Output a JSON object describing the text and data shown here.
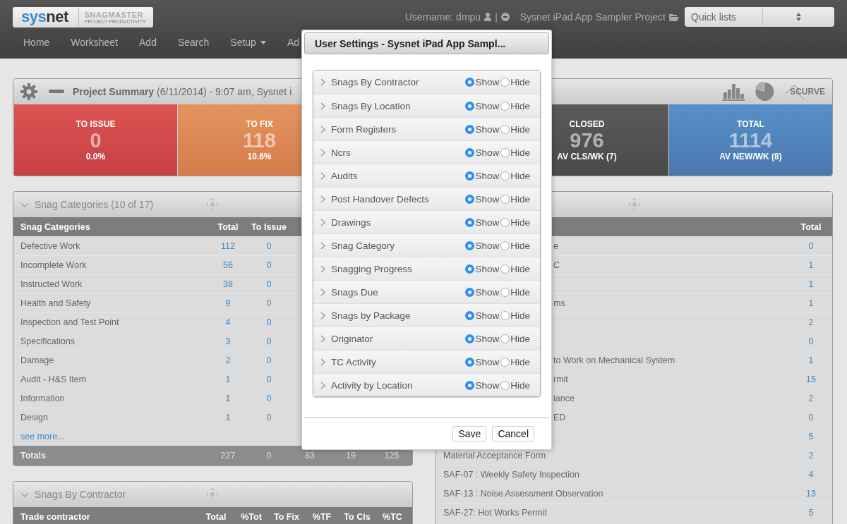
{
  "header": {
    "logo": {
      "brand": [
        "sys",
        "net"
      ],
      "product": "SNAGMASTER",
      "tagline": "PROJECT PRODUCTIVITY"
    },
    "username": "Username: dmpu",
    "separator": "|",
    "project": "Sysnet iPad App Sampler Project",
    "quick_lists": {
      "value": "Quick lists"
    }
  },
  "nav": [
    {
      "label": "Home",
      "dropdown": false
    },
    {
      "label": "Worksheet",
      "dropdown": false
    },
    {
      "label": "Add",
      "dropdown": false
    },
    {
      "label": "Search",
      "dropdown": false
    },
    {
      "label": "Setup",
      "dropdown": true
    },
    {
      "label": "Ad",
      "dropdown": false
    }
  ],
  "summary": {
    "title": "Project Summary",
    "subtitle": "(6/11/2014) - 9:07 am,  Sysnet i",
    "curve_button": "SCURVE",
    "cards": [
      {
        "kind": "issue",
        "label": "TO ISSUE",
        "value": "0",
        "note": "0.0%"
      },
      {
        "kind": "fix",
        "label": "TO FIX",
        "value": "118",
        "note": "10.6%"
      },
      {
        "kind": "closed",
        "label": "CLOSED",
        "value": "976",
        "note": "AV CLS/WK (7)"
      },
      {
        "kind": "total",
        "label": "TOTAL",
        "value": "1114",
        "note": "AV NEW/WK (8)"
      }
    ]
  },
  "categories_panel": {
    "title": "Snag Categories (10 of 17)",
    "columns": [
      "Snag Categories",
      "Total",
      "To Issue"
    ],
    "rows": [
      {
        "name": "Defective Work",
        "total": "112",
        "to_issue": "0"
      },
      {
        "name": "Incomplete Work",
        "total": "56",
        "to_issue": "0"
      },
      {
        "name": "Instructed Work",
        "total": "38",
        "to_issue": "0"
      },
      {
        "name": "Health and Safety",
        "total": "9",
        "to_issue": "0"
      },
      {
        "name": "Inspection and Test Point",
        "total": "4",
        "to_issue": "0"
      },
      {
        "name": "Specifications",
        "total": "3",
        "to_issue": "0"
      },
      {
        "name": "Damage",
        "total": "2",
        "to_issue": "0"
      },
      {
        "name": "Audit - H&S Item",
        "total": "1",
        "to_issue": "0"
      },
      {
        "name": "Information",
        "total": "1",
        "to_issue": "0"
      },
      {
        "name": "Design",
        "total": "1",
        "to_issue": "0"
      }
    ],
    "see_more": "see more...",
    "totals": [
      "Totals",
      "227",
      "0",
      "83",
      "19",
      "125"
    ]
  },
  "contractor_panel": {
    "title": "Snags By Contractor",
    "columns": [
      "Trade contractor",
      "Total",
      "%Tot",
      "To Fix",
      "%TF",
      "To Cls",
      "%TC"
    ]
  },
  "right_panel": {
    "columns": [
      "Total"
    ],
    "rows": [
      {
        "name": "e",
        "total": "0"
      },
      {
        "name": "C",
        "total": "1"
      },
      {
        "total": "1"
      },
      {
        "name": "ms",
        "total": "1"
      },
      {
        "total": "2"
      },
      {
        "total": "0"
      },
      {
        "name": "to Work on Mechanical System",
        "total": "1"
      },
      {
        "name": "rmit",
        "total": "15"
      },
      {
        "name": "iance",
        "total": "2"
      },
      {
        "name": "ED",
        "total": "0"
      },
      {
        "total": "5"
      },
      {
        "name": "Material Acceptance Form",
        "total": "2"
      },
      {
        "name": "SAF-07 : Weekly Safety Inspection",
        "total": "4"
      },
      {
        "name": "SAF-13 : Noise Assessment Observation",
        "total": "13"
      },
      {
        "name": "SAF-27: Hot Works Permit",
        "total": "5"
      }
    ]
  },
  "modal": {
    "title": "User Settings - Sysnet iPad App Sampl...",
    "items": [
      {
        "label": "Snags By Contractor",
        "options": [
          {
            "label": "Show",
            "selected": true
          },
          {
            "label": "Hide",
            "selected": false
          }
        ]
      },
      {
        "label": "Snags By Location",
        "options": [
          {
            "label": "Show",
            "selected": true
          },
          {
            "label": "Hide",
            "selected": false
          }
        ]
      },
      {
        "label": "Form Registers",
        "options": [
          {
            "label": "Show",
            "selected": true
          },
          {
            "label": "Hide",
            "selected": false
          }
        ]
      },
      {
        "label": "Ncrs",
        "options": [
          {
            "label": "Show",
            "selected": true
          },
          {
            "label": "Hide",
            "selected": false
          }
        ]
      },
      {
        "label": "Audits",
        "options": [
          {
            "label": "Show",
            "selected": true
          },
          {
            "label": "Hide",
            "selected": false
          }
        ]
      },
      {
        "label": "Post Handover Defects",
        "options": [
          {
            "label": "Show",
            "selected": true
          },
          {
            "label": "Hide",
            "selected": false
          }
        ]
      },
      {
        "label": "Drawings",
        "options": [
          {
            "label": "Show",
            "selected": true
          },
          {
            "label": "Hide",
            "selected": false
          }
        ]
      },
      {
        "label": "Snag Category",
        "options": [
          {
            "label": "Show",
            "selected": true
          },
          {
            "label": "Hide",
            "selected": false
          }
        ]
      },
      {
        "label": "Snagging Progress",
        "options": [
          {
            "label": "Show",
            "selected": true
          },
          {
            "label": "Hide",
            "selected": false
          }
        ]
      },
      {
        "label": "Snags Due",
        "options": [
          {
            "label": "Show",
            "selected": true
          },
          {
            "label": "Hide",
            "selected": false
          }
        ]
      },
      {
        "label": "Snags by Package",
        "options": [
          {
            "label": "Show",
            "selected": true
          },
          {
            "label": "Hide",
            "selected": false
          }
        ]
      },
      {
        "label": "Originator",
        "options": [
          {
            "label": "Show",
            "selected": true
          },
          {
            "label": "Hide",
            "selected": false
          }
        ]
      },
      {
        "label": "TC Activity",
        "options": [
          {
            "label": "Show",
            "selected": true
          },
          {
            "label": "Hide",
            "selected": false
          }
        ]
      },
      {
        "label": "Activity by Location",
        "options": [
          {
            "label": "Show",
            "selected": true
          },
          {
            "label": "Hide",
            "selected": false
          }
        ]
      }
    ],
    "buttons": [
      "Save",
      "Cancel"
    ]
  }
}
